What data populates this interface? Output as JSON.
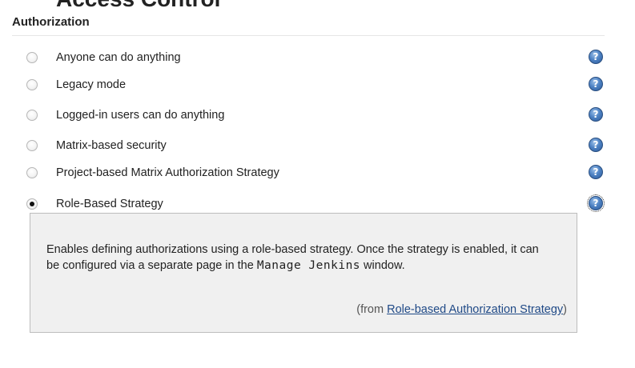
{
  "page": {
    "clipped_heading": "Access Control"
  },
  "authorization": {
    "section_title": "Authorization",
    "options": [
      {
        "label": "Anyone can do anything",
        "selected": false
      },
      {
        "label": "Legacy mode",
        "selected": false
      },
      {
        "label": "Logged-in users can do anything",
        "selected": false
      },
      {
        "label": "Matrix-based security",
        "selected": false
      },
      {
        "label": "Project-based Matrix Authorization Strategy",
        "selected": false
      },
      {
        "label": "Role-Based Strategy",
        "selected": true
      }
    ],
    "help_icon": "help-icon",
    "help_box": {
      "text_before": "Enables defining authorizations using a role-based strategy. Once the strategy is enabled, it can be configured via a separate page in the ",
      "code": "Manage Jenkins",
      "text_after": " window.",
      "source_prefix": "(from ",
      "source_link": "Role-based Authorization Strategy",
      "source_suffix": ")"
    }
  },
  "colors": {
    "link": "#204a87",
    "help_box_bg": "#f0f0f0",
    "help_icon": "#4f83c4"
  }
}
